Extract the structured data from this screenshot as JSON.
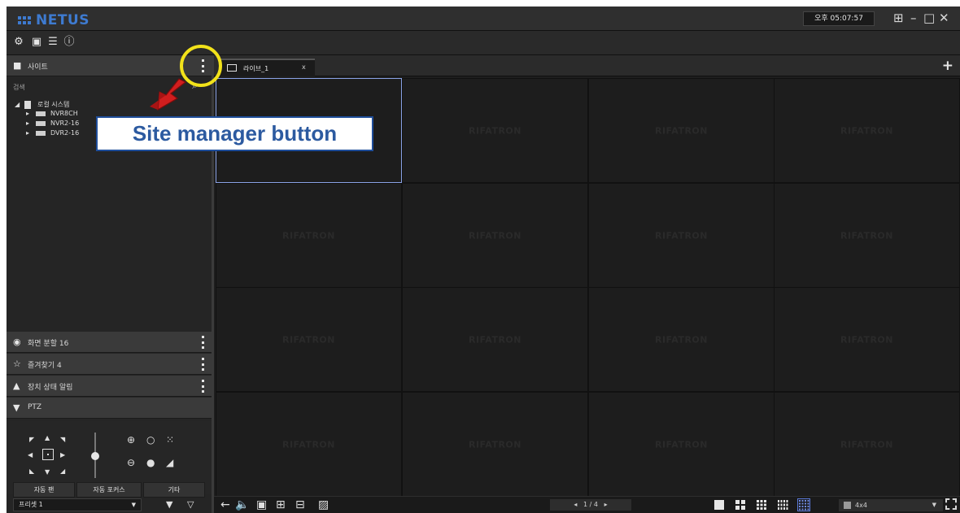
{
  "app": {
    "title": "NETUS"
  },
  "clock": "오후 05:07:57",
  "toolbar": {
    "icons": [
      "gear-icon",
      "calendar-icon",
      "list-icon",
      "info-icon"
    ]
  },
  "site_panel": {
    "title": "사이트",
    "search_label": "검색",
    "tree": {
      "root": "로컬 시스템",
      "devices": [
        "NVR8CH",
        "NVR2-16",
        "DVR2-16"
      ]
    }
  },
  "panels": [
    {
      "label": "화면 분할 16"
    },
    {
      "label": "즐겨찾기 4"
    },
    {
      "label": "장치 상태 알림"
    },
    {
      "label": "PTZ"
    }
  ],
  "ptz": {
    "tabs": [
      "자동 팬",
      "자동 포커스",
      "기타"
    ],
    "preset": "프리셋 1"
  },
  "live_tab": {
    "label": "라이브_1",
    "close": "x"
  },
  "add_tab": "+",
  "watermark": "RIFATRON",
  "pager": "1 / 4",
  "layout_select": "4x4",
  "annotation": {
    "callout": "Site manager button"
  },
  "colors": {
    "accent": "#3e7bd1",
    "highlight_ring": "#f2e21a",
    "pointer": "#d11e1e",
    "selection": "#8aa2e6"
  }
}
